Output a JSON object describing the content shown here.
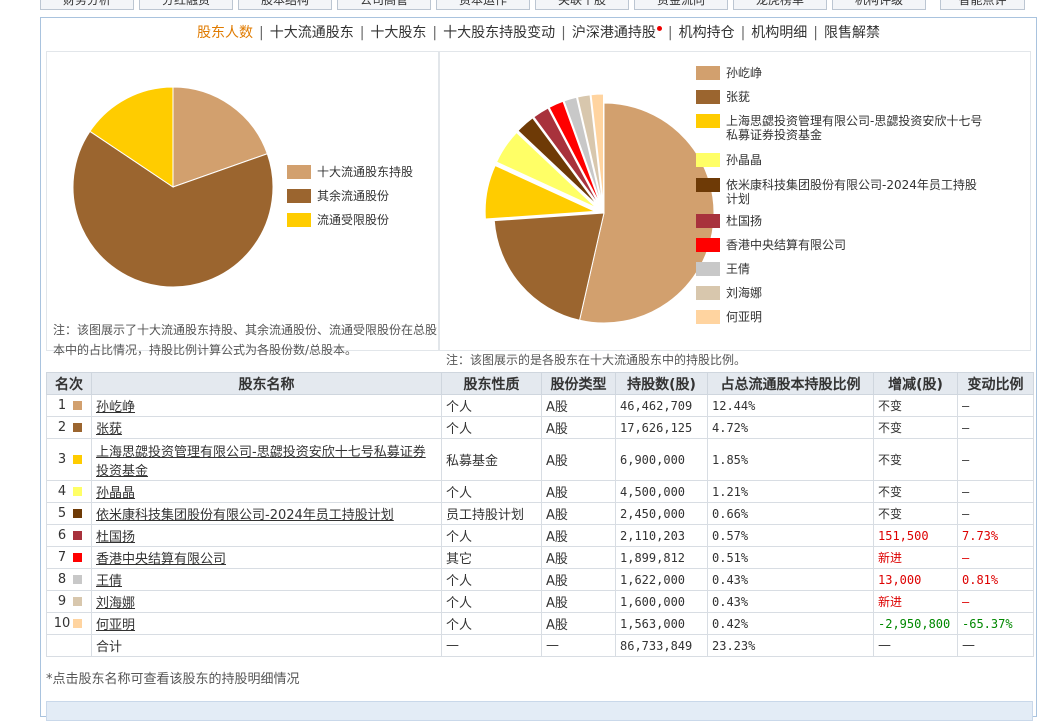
{
  "top_tabs": [
    "财务分析",
    "分红融资",
    "股本结构",
    "公司高管",
    "资本运作",
    "关联个股",
    "资金流向",
    "龙虎榜单",
    "机构评级",
    "智能点评"
  ],
  "subnav": [
    {
      "label": "股东人数",
      "active": true,
      "dot": false
    },
    {
      "label": "十大流通股东",
      "active": false,
      "dot": false
    },
    {
      "label": "十大股东",
      "active": false,
      "dot": false
    },
    {
      "label": "十大股东持股变动",
      "active": false,
      "dot": false
    },
    {
      "label": "沪深港通持股",
      "active": false,
      "dot": true
    },
    {
      "label": "机构持仓",
      "active": false,
      "dot": false
    },
    {
      "label": "机构明细",
      "active": false,
      "dot": false
    },
    {
      "label": "限售解禁",
      "active": false,
      "dot": false
    }
  ],
  "chart_data": [
    {
      "type": "pie",
      "labels": [
        "十大流通股东持股",
        "其余流通股份",
        "流通受限股份"
      ],
      "values": [
        19.6,
        64.8,
        15.6
      ],
      "colors": [
        "#d2a06e",
        "#9b652f",
        "#ffcc00"
      ]
    },
    {
      "type": "pie",
      "labels": [
        "孙屹峥",
        "张莸",
        "上海思勰投资管理有限公司-思勰投资安欣十七号私募证券投资基金",
        "孙晶晶",
        "依米康科技集团股份有限公司-2024年员工持股计划",
        "杜国扬",
        "香港中央结算有限公司",
        "王倩",
        "刘海娜",
        "何亚明"
      ],
      "values": [
        46462709,
        17626125,
        6900000,
        4500000,
        2450000,
        2110203,
        1899812,
        1622000,
        1600000,
        1563000
      ],
      "colors": [
        "#d2a06e",
        "#9b652f",
        "#ffcc00",
        "#ffff66",
        "#6e3a06",
        "#a8323c",
        "#ff0000",
        "#c8c8c8",
        "#d8c7ad",
        "#ffd4a0"
      ]
    }
  ],
  "note1": "注：该图展示了十大流通股东持股、其余流通股份、流通受限股份在总股本中的占比情况，持股比例计算公式为各股份数/总股本。",
  "note2": "注：该图展示的是各股东在十大流通股东中的持股比例。",
  "table": {
    "headers": [
      "名次",
      "股东名称",
      "股东性质",
      "股份类型",
      "持股数(股)",
      "占总流通股本持股比例",
      "增减(股)",
      "变动比例"
    ],
    "rows": [
      {
        "rank": "1",
        "color": "#d2a06e",
        "name": "孙屹峥",
        "nature": "个人",
        "type": "A股",
        "shares": "46,462,709",
        "ratio": "12.44%",
        "change": "不变",
        "change_cls": "",
        "pct": "—",
        "pct_cls": ""
      },
      {
        "rank": "2",
        "color": "#9b652f",
        "name": "张莸",
        "nature": "个人",
        "type": "A股",
        "shares": "17,626,125",
        "ratio": "4.72%",
        "change": "不变",
        "change_cls": "",
        "pct": "—",
        "pct_cls": ""
      },
      {
        "rank": "3",
        "color": "#ffcc00",
        "name": "上海思勰投资管理有限公司-思勰投资安欣十七号私募证券投资基金",
        "nature": "私募基金",
        "type": "A股",
        "shares": "6,900,000",
        "ratio": "1.85%",
        "change": "不变",
        "change_cls": "",
        "pct": "—",
        "pct_cls": ""
      },
      {
        "rank": "4",
        "color": "#ffff66",
        "name": "孙晶晶",
        "nature": "个人",
        "type": "A股",
        "shares": "4,500,000",
        "ratio": "1.21%",
        "change": "不变",
        "change_cls": "",
        "pct": "—",
        "pct_cls": ""
      },
      {
        "rank": "5",
        "color": "#6e3a06",
        "name": "依米康科技集团股份有限公司-2024年员工持股计划",
        "nature": "员工持股计划",
        "type": "A股",
        "shares": "2,450,000",
        "ratio": "0.66%",
        "change": "不变",
        "change_cls": "",
        "pct": "—",
        "pct_cls": ""
      },
      {
        "rank": "6",
        "color": "#a8323c",
        "name": "杜国扬",
        "nature": "个人",
        "type": "A股",
        "shares": "2,110,203",
        "ratio": "0.57%",
        "change": "151,500",
        "change_cls": "red",
        "pct": "7.73%",
        "pct_cls": "red"
      },
      {
        "rank": "7",
        "color": "#ff0000",
        "name": "香港中央结算有限公司",
        "nature": "其它",
        "type": "A股",
        "shares": "1,899,812",
        "ratio": "0.51%",
        "change": "新进",
        "change_cls": "red",
        "pct": "—",
        "pct_cls": "red"
      },
      {
        "rank": "8",
        "color": "#c8c8c8",
        "name": "王倩",
        "nature": "个人",
        "type": "A股",
        "shares": "1,622,000",
        "ratio": "0.43%",
        "change": "13,000",
        "change_cls": "red",
        "pct": "0.81%",
        "pct_cls": "red"
      },
      {
        "rank": "9",
        "color": "#d8c7ad",
        "name": "刘海娜",
        "nature": "个人",
        "type": "A股",
        "shares": "1,600,000",
        "ratio": "0.43%",
        "change": "新进",
        "change_cls": "red",
        "pct": "—",
        "pct_cls": "red"
      },
      {
        "rank": "10",
        "color": "#ffd4a0",
        "name": "何亚明",
        "nature": "个人",
        "type": "A股",
        "shares": "1,563,000",
        "ratio": "0.42%",
        "change": "-2,950,800",
        "change_cls": "green",
        "pct": "-65.37%",
        "pct_cls": "green"
      }
    ],
    "total": {
      "label": "合计",
      "nature": "—",
      "type": "—",
      "shares": "86,733,849",
      "ratio": "23.23%",
      "change": "—",
      "pct": "—"
    }
  },
  "footnote": "*点击股东名称可查看该股东的持股明细情况"
}
